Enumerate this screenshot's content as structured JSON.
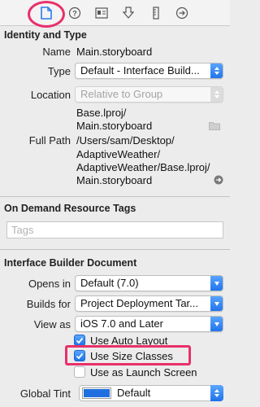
{
  "toolbar": {
    "icons": [
      "file-inspector-icon",
      "quick-help-icon",
      "identity-inspector-icon",
      "attributes-inspector-icon",
      "size-inspector-icon",
      "connections-inspector-icon"
    ],
    "selected_index": 0,
    "highlight_color": "#e8306a"
  },
  "identity": {
    "title": "Identity and Type",
    "name_label": "Name",
    "name_value": "Main.storyboard",
    "type_label": "Type",
    "type_value": "Default - Interface Build...",
    "location_label": "Location",
    "location_value": "Relative to Group",
    "location_path_line1": "Base.lproj/",
    "location_path_line2": "Main.storyboard",
    "fullpath_label": "Full Path",
    "fullpath_line1": "/Users/sam/Desktop/",
    "fullpath_line2": "AdaptiveWeather/",
    "fullpath_line3": "AdaptiveWeather/Base.lproj/",
    "fullpath_line4": "Main.storyboard"
  },
  "odr": {
    "title": "On Demand Resource Tags",
    "tags_placeholder": "Tags"
  },
  "ib_doc": {
    "title": "Interface Builder Document",
    "opens_in_label": "Opens in",
    "opens_in_value": "Default (7.0)",
    "builds_for_label": "Builds for",
    "builds_for_value": "Project Deployment Tar...",
    "view_as_label": "View as",
    "view_as_value": "iOS 7.0 and Later",
    "use_auto_layout": {
      "label": "Use Auto Layout",
      "checked": true
    },
    "use_size_classes": {
      "label": "Use Size Classes",
      "checked": true
    },
    "use_as_launch_screen": {
      "label": "Use as Launch Screen",
      "checked": false
    },
    "global_tint_label": "Global Tint",
    "global_tint_value": "Default",
    "global_tint_color": "#1f6fe0"
  },
  "colors": {
    "accent": "#2b7bf0",
    "highlight": "#e8306a"
  }
}
